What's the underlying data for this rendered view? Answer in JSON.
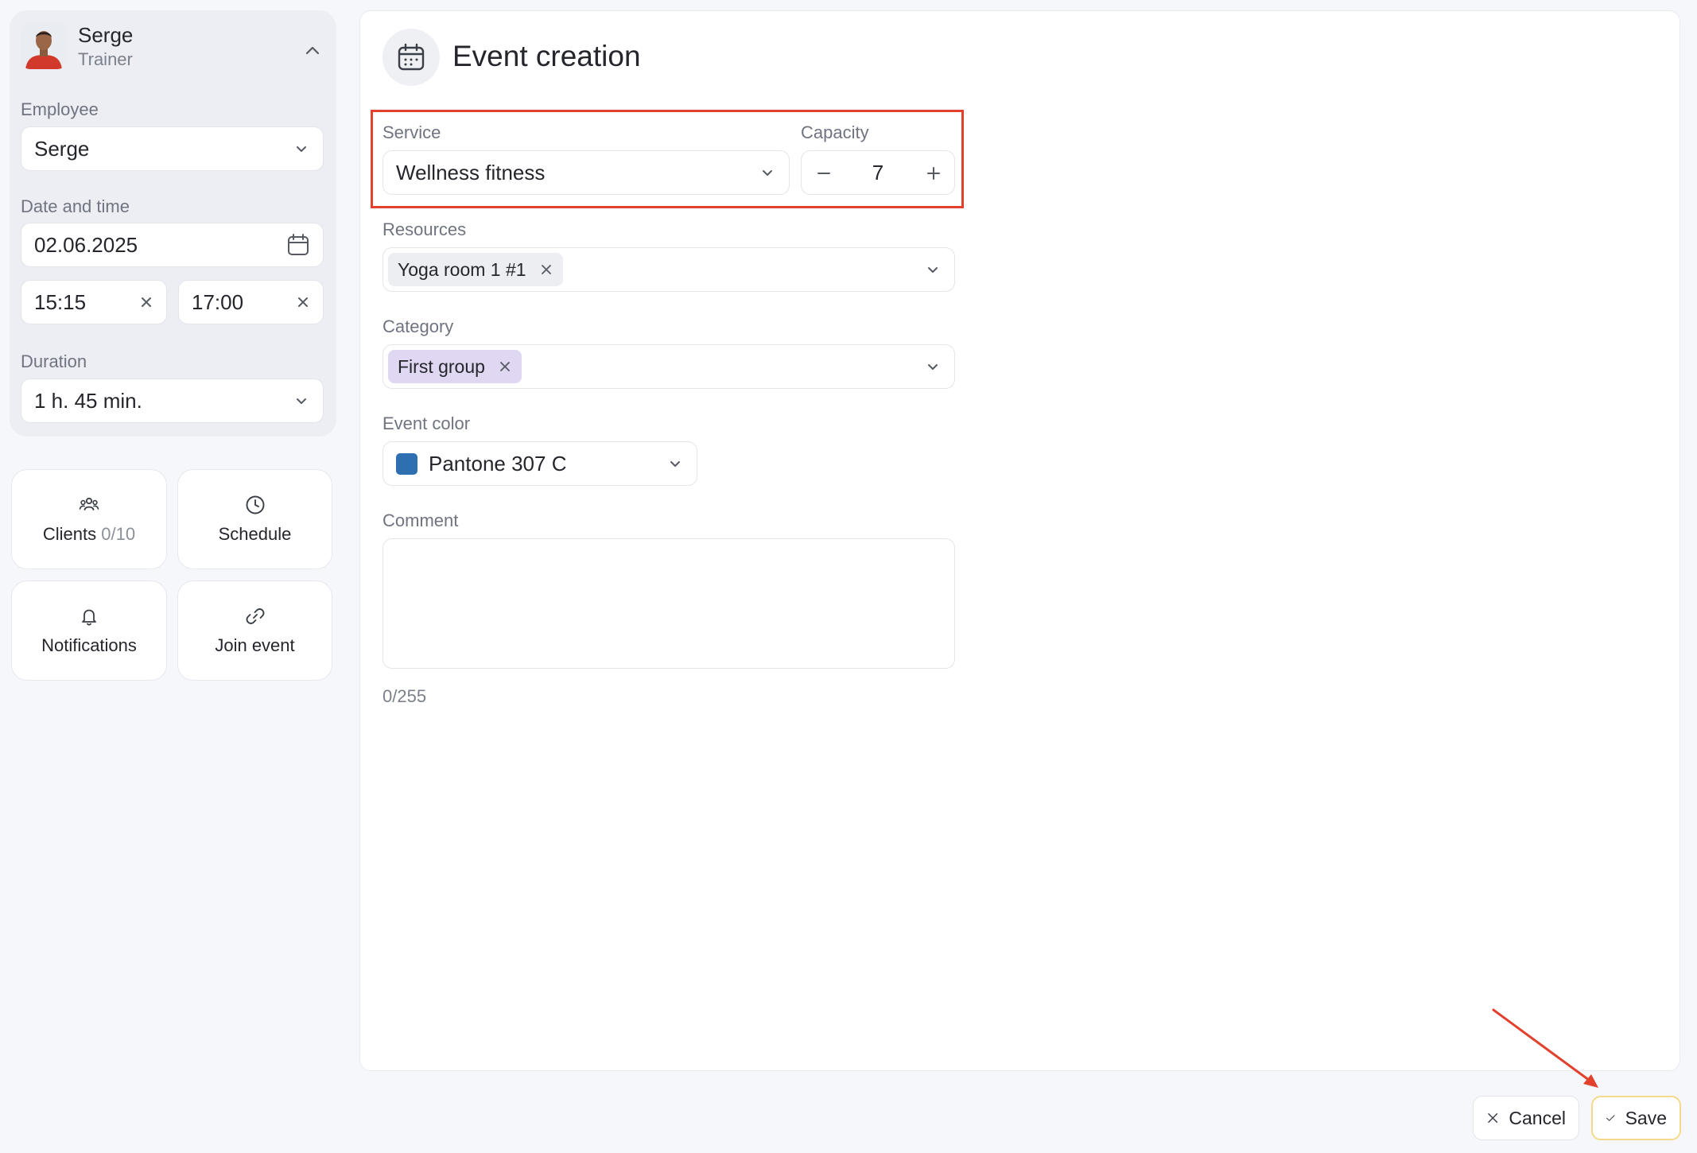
{
  "profile": {
    "name": "Serge",
    "role": "Trainer"
  },
  "left_panel": {
    "employee_label": "Employee",
    "employee_value": "Serge",
    "datetime_label": "Date and time",
    "date_value": "02.06.2025",
    "start_time": "15:15",
    "end_time": "17:00",
    "duration_label": "Duration",
    "duration_value": "1 h. 45 min."
  },
  "tiles": {
    "clients_label": "Clients",
    "clients_count": "0/10",
    "schedule_label": "Schedule",
    "notifications_label": "Notifications",
    "join_label": "Join event"
  },
  "form": {
    "title": "Event creation",
    "service_label": "Service",
    "service_value": "Wellness fitness",
    "capacity_label": "Capacity",
    "capacity_value": "7",
    "resources_label": "Resources",
    "resources_chip": "Yoga room 1 #1",
    "category_label": "Category",
    "category_chip": "First group",
    "color_label": "Event color",
    "color_value": "Pantone 307 C",
    "color_hex": "#2d6fb0",
    "comment_label": "Comment",
    "comment_counter": "0/255"
  },
  "footer": {
    "cancel_label": "Cancel",
    "save_label": "Save"
  },
  "colors": {
    "highlight": "#e2412d",
    "annotation_arrow": "#e2412d",
    "save_border": "#f5d98a",
    "category_chip_bg": "#e0d8f2"
  }
}
